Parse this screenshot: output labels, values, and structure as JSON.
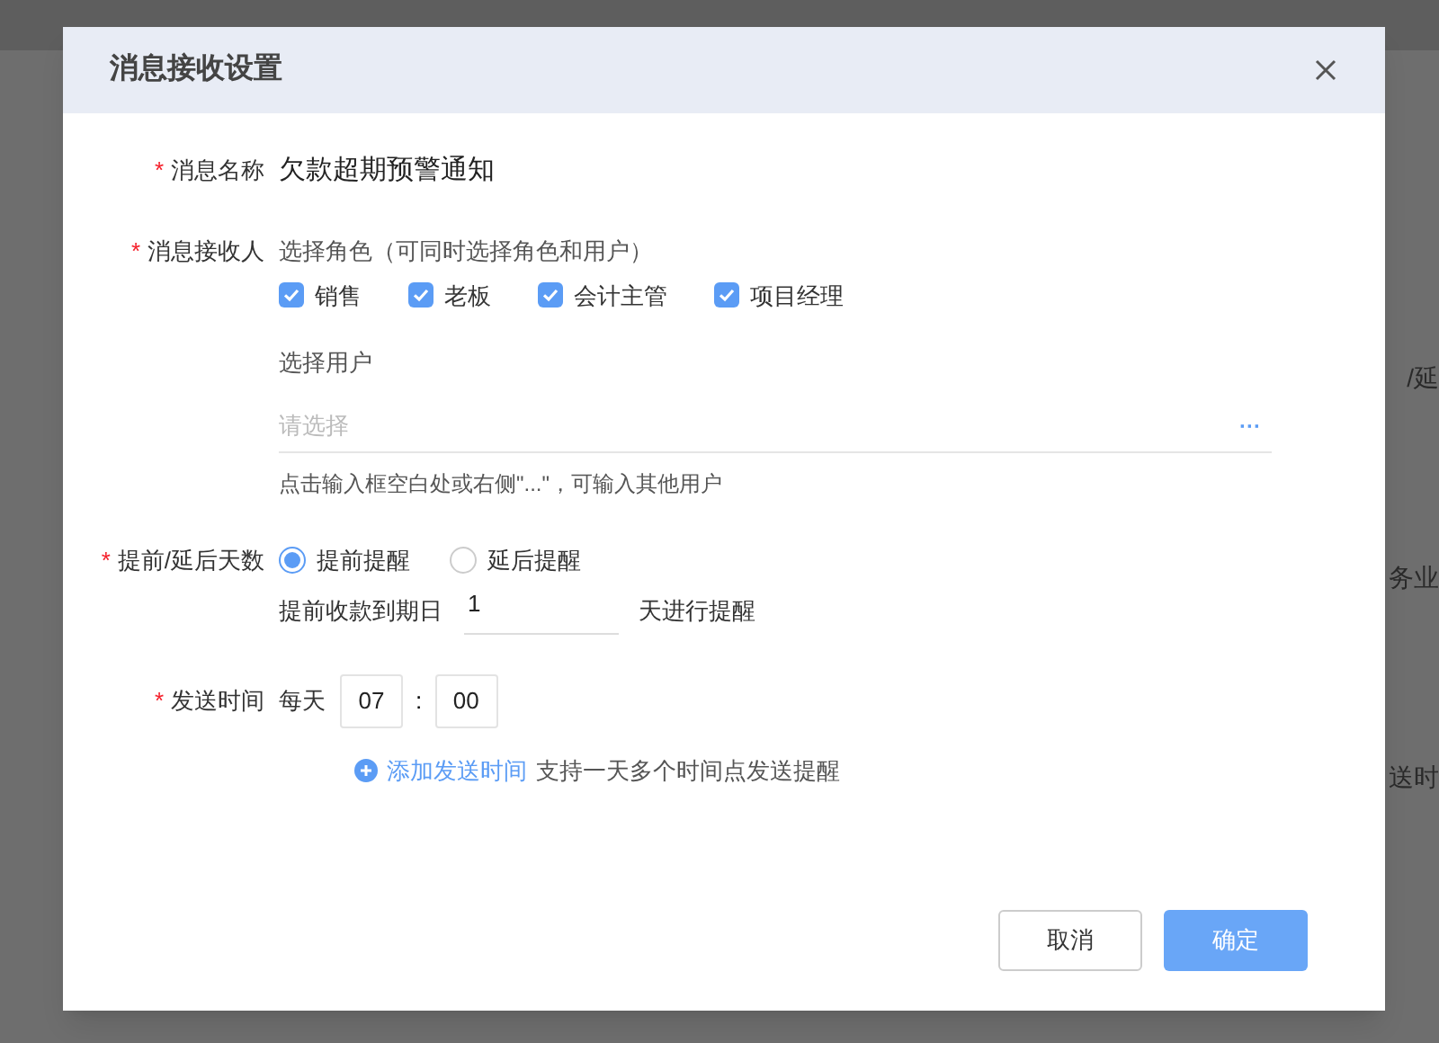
{
  "background_fragments": [
    "/延",
    "务业",
    "送时"
  ],
  "dialog": {
    "title": "消息接收设置",
    "name_field": {
      "label": "消息名称",
      "required_mark": "*",
      "value": "欠款超期预警通知"
    },
    "recipients": {
      "label": "消息接收人",
      "required_mark": "*",
      "roles_hint": "选择角色（可同时选择角色和用户）",
      "roles": [
        {
          "label": "销售",
          "checked": true
        },
        {
          "label": "老板",
          "checked": true
        },
        {
          "label": "会计主管",
          "checked": true
        },
        {
          "label": "项目经理",
          "checked": true
        }
      ],
      "users_label": "选择用户",
      "users_placeholder": "请选择",
      "users_more": "···",
      "users_help": "点击输入框空白处或右侧\"...\"，可输入其他用户"
    },
    "days": {
      "label": "提前/延后天数",
      "required_mark": "*",
      "options": [
        {
          "label": "提前提醒",
          "selected": true
        },
        {
          "label": "延后提醒",
          "selected": false
        }
      ],
      "prefix": "提前收款到期日",
      "value": "1",
      "suffix": "天进行提醒"
    },
    "send_time": {
      "label": "发送时间",
      "required_mark": "*",
      "prefix": "每天",
      "hour": "07",
      "separator": ":",
      "minute": "00",
      "add_link": "添加发送时间",
      "add_hint": "支持一天多个时间点发送提醒"
    },
    "buttons": [
      {
        "label": "取消",
        "kind": "secondary"
      },
      {
        "label": "确定",
        "kind": "primary"
      }
    ]
  }
}
